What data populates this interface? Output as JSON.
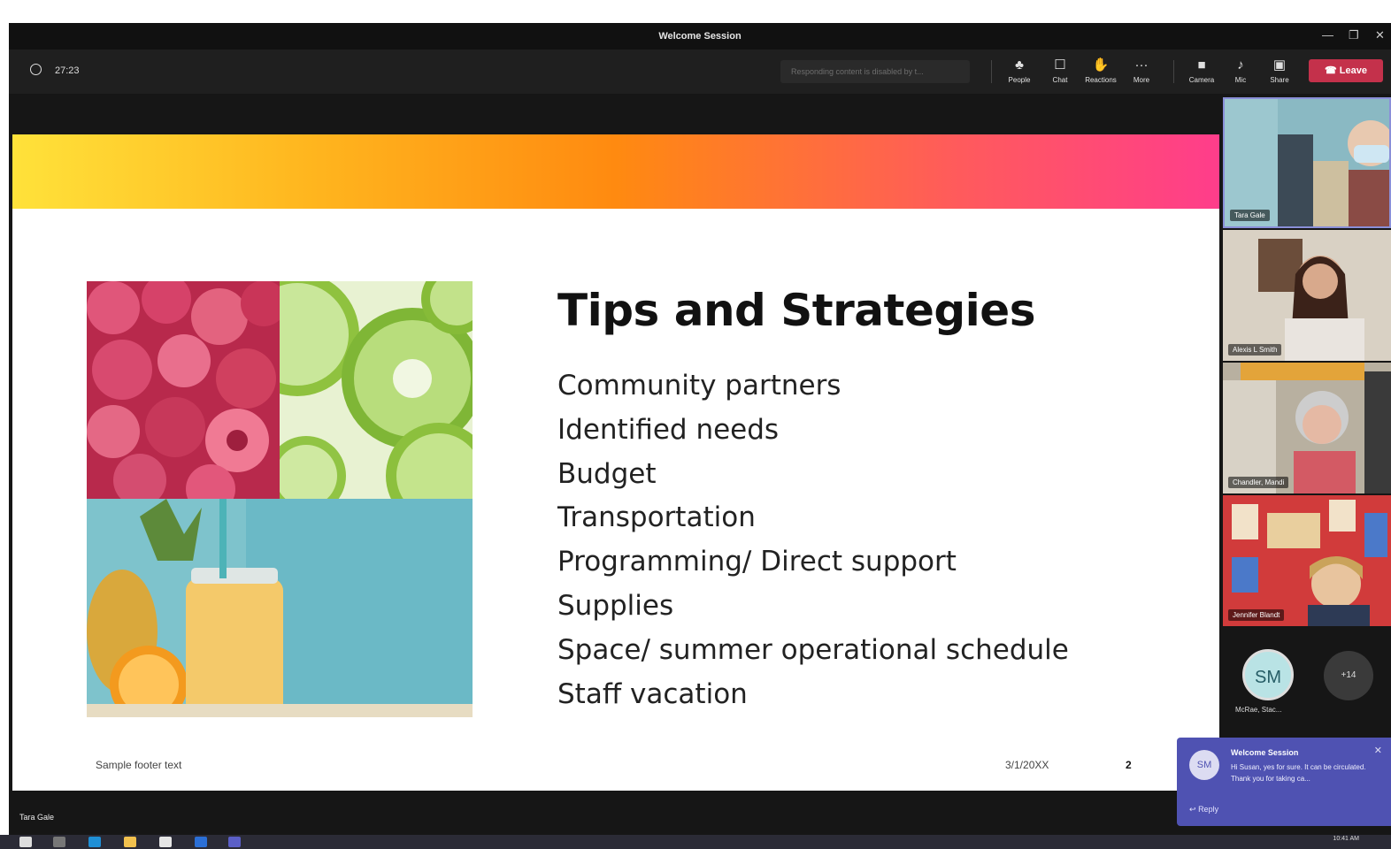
{
  "window": {
    "title": "Welcome Session",
    "minimize": "—",
    "maximize": "❐",
    "close": "✕"
  },
  "toolbar": {
    "timer": "27:23",
    "notice": "Responding content is disabled by t...",
    "buttons": [
      {
        "label": "People",
        "icon": "people-icon",
        "glyph": "♣"
      },
      {
        "label": "Chat",
        "icon": "chat-icon",
        "glyph": "☐"
      },
      {
        "label": "Reactions",
        "icon": "reactions-icon",
        "glyph": "✋"
      },
      {
        "label": "More",
        "icon": "more-icon",
        "glyph": "···"
      },
      {
        "label": "Camera",
        "icon": "camera-icon",
        "glyph": "■"
      },
      {
        "label": "Mic",
        "icon": "mic-icon",
        "glyph": "♪"
      },
      {
        "label": "Share",
        "icon": "share-icon",
        "glyph": "▣"
      }
    ],
    "leave_label": "Leave",
    "leave_icon": "phone-icon"
  },
  "slide": {
    "title": "Tips and Strategies",
    "bullets": [
      "Community partners",
      "Identified needs",
      "Budget",
      "Transportation",
      "Programming/ Direct support",
      "Supplies",
      "Space/ summer operational schedule",
      "Staff vacation"
    ],
    "footer_text": "Sample footer text",
    "date": "3/1/20XX",
    "page_number": "2",
    "banner_colors": [
      "#ffe23a",
      "#ff8a10",
      "#ff3d8b"
    ]
  },
  "presenter_label": "Tara Gale",
  "participants": [
    {
      "name": "Tara Gale",
      "active": true
    },
    {
      "name": "Alexis L Smith"
    },
    {
      "name": "Chandler, Mandi"
    },
    {
      "name": "Jennifer Blandt"
    }
  ],
  "avatar": {
    "initials": "SM",
    "name": "McRae, Stac...",
    "more_count": "+14"
  },
  "toast": {
    "initials": "SM",
    "title": "Welcome Session",
    "message": "Hi Susan, yes for sure. It can be circulated. Thank you for taking ca...",
    "reply_label": "Reply",
    "close": "✕"
  },
  "taskbar": {
    "time": "10:41 AM"
  }
}
